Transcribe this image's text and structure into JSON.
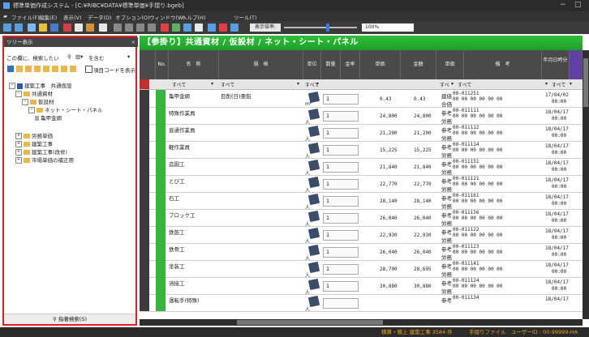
{
  "window": {
    "title": "標準単価作成システム - [C:¥RIBC¥DATA¥標準単価¥手摺り.bgeb]",
    "minimize": "−",
    "restore": "□"
  },
  "menu": [
    "ファイル(F)",
    "編集(E)",
    "表示(V)",
    "データ(D)",
    "オプション(O)",
    "ウィンドウ(W)",
    "ヘルプ(H)",
    "ツール(T)"
  ],
  "toolbar": {
    "zoom_label": "表示倍率:",
    "zoom_value": "100%",
    "zoom_level_percent": 100
  },
  "tree": {
    "header": "ツリー表示",
    "close": "×",
    "search_label": "この欄に、検索したい",
    "search_mode": "を含む",
    "code_checkbox_label": "項目コードを表示",
    "nodes": [
      {
        "label": "建築工事　共通仮設",
        "level": 0,
        "type": "book",
        "exp": "−"
      },
      {
        "label": "共通資材",
        "level": 1,
        "type": "folder",
        "exp": "−"
      },
      {
        "label": "仮設材",
        "level": 2,
        "type": "folder",
        "exp": "−"
      },
      {
        "label": "ネット・シート・パネル",
        "level": 3,
        "type": "folder",
        "exp": "−"
      },
      {
        "label": "亀甲金網",
        "level": 4,
        "type": "leaf",
        "exp": ""
      },
      {
        "label": "労務単価",
        "level": 1,
        "type": "folder",
        "exp": "+"
      },
      {
        "label": "建築工事",
        "level": 1,
        "type": "folder",
        "exp": "+"
      },
      {
        "label": "建築工事(改修)",
        "level": 1,
        "type": "folder",
        "exp": "+"
      },
      {
        "label": "市場単価の補正用",
        "level": 1,
        "type": "folder",
        "exp": "+"
      }
    ],
    "footer": "指著検索(S)"
  },
  "main": {
    "header": "【参掛り】共通資材 / 仮設材 / ネット・シート・パネル",
    "columns": [
      "No.",
      "名　称",
      "規　格",
      "単位",
      "数量",
      "金率",
      "単価",
      "金額",
      "単価",
      "備　考",
      "年月日時分"
    ],
    "filters": {
      "name": "すべて",
      "spec": "すべて",
      "unit": "すべて",
      "price_kind": "すべ",
      "remarks": "すべて",
      "date": "すべて"
    },
    "rows": [
      {
        "name": "亀甲金網",
        "spec": "目削(日)亜鉛",
        "unit": "m²",
        "qty": "1",
        "price": "0.43",
        "amount": "0.43",
        "kind": "建値",
        "kind2": "合価",
        "code": "00-011251",
        "remarks": "00 00 00 00 00 00",
        "date": "17/04/02",
        "time": "00:00"
      },
      {
        "name": "特殊作業員",
        "spec": "",
        "unit": "人",
        "qty": "1",
        "price": "24,800",
        "amount": "24,800",
        "kind": "参考",
        "kind2": "労務",
        "code": "00-011111",
        "remarks": "00 00 00 00 00 00",
        "date": "18/04/17",
        "time": "00:00"
      },
      {
        "name": "普通作業員",
        "spec": "",
        "unit": "人",
        "qty": "1",
        "price": "21,200",
        "amount": "21,200",
        "kind": "参考",
        "kind2": "労務",
        "code": "00-011112",
        "remarks": "00 00 00 00 00 00",
        "date": "18/04/17",
        "time": "00:00"
      },
      {
        "name": "軽作業員",
        "spec": "",
        "unit": "人",
        "qty": "1",
        "price": "15,225",
        "amount": "15,225",
        "kind": "参考",
        "kind2": "労務",
        "code": "00-011114",
        "remarks": "00 00 00 00 00 00",
        "date": "18/04/17",
        "time": "00:00"
      },
      {
        "name": "造園工",
        "spec": "",
        "unit": "人",
        "qty": "1",
        "price": "21,840",
        "amount": "21,840",
        "kind": "参考",
        "kind2": "労務",
        "code": "00-011151",
        "remarks": "00 00 00 00 00 00",
        "date": "18/04/17",
        "time": "00:00"
      },
      {
        "name": "とび工",
        "spec": "",
        "unit": "人",
        "qty": "1",
        "price": "22,770",
        "amount": "22,770",
        "kind": "参考",
        "kind2": "労務",
        "code": "00-011121",
        "remarks": "00 00 00 00 00 00",
        "date": "18/04/17",
        "time": "00:00"
      },
      {
        "name": "石工",
        "spec": "",
        "unit": "人",
        "qty": "1",
        "price": "28,140",
        "amount": "28,140",
        "kind": "参考",
        "kind2": "労務",
        "code": "00-011161",
        "remarks": "00 00 00 00 00 00",
        "date": "18/04/17",
        "time": "00:00"
      },
      {
        "name": "ブロック工",
        "spec": "",
        "unit": "人",
        "qty": "1",
        "price": "26,040",
        "amount": "26,040",
        "kind": "参考",
        "kind2": "労務",
        "code": "00-011156",
        "remarks": "00 00 00 00 00 00",
        "date": "18/04/17",
        "time": "00:00"
      },
      {
        "name": "鉄筋工",
        "spec": "",
        "unit": "人",
        "qty": "1",
        "price": "22,930",
        "amount": "22,930",
        "kind": "参考",
        "kind2": "労務",
        "code": "00-011122",
        "remarks": "00 00 00 00 00 00",
        "date": "18/04/17",
        "time": "00:00"
      },
      {
        "name": "鉄骨工",
        "spec": "",
        "unit": "人",
        "qty": "1",
        "price": "26,040",
        "amount": "26,040",
        "kind": "参考",
        "kind2": "労務",
        "code": "00-011123",
        "remarks": "00 00 00 00 00 00",
        "date": "18/04/17",
        "time": "00:00"
      },
      {
        "name": "塗装工",
        "spec": "",
        "unit": "人",
        "qty": "1",
        "price": "28,700",
        "amount": "28,695",
        "kind": "参考",
        "kind2": "労務",
        "code": "00-011141",
        "remarks": "00 00 00 00 00 00",
        "date": "18/04/17",
        "time": "00:00"
      },
      {
        "name": "溶接工",
        "spec": "",
        "unit": "人",
        "qty": "1",
        "price": "30,880",
        "amount": "30,880",
        "kind": "参考",
        "kind2": "労務",
        "code": "00-011124",
        "remarks": "00 00 00 00 00 00",
        "date": "18/04/17",
        "time": "00:00"
      },
      {
        "name": "運転手(特殊)",
        "spec": "",
        "unit": "人",
        "qty": "",
        "price": "",
        "amount": "",
        "kind": "参考",
        "kind2": "",
        "code": "00-011134",
        "remarks": "",
        "date": "18/04/17",
        "time": ""
      }
    ]
  },
  "status": {
    "left": "積算・積上 建築工事 3584 件",
    "mid": "手摺りファイル",
    "right": "ユーザーID : 00-99999-HA"
  },
  "colors": {
    "accent_green": "#2fbf3a",
    "highlight_red": "#e02020"
  }
}
